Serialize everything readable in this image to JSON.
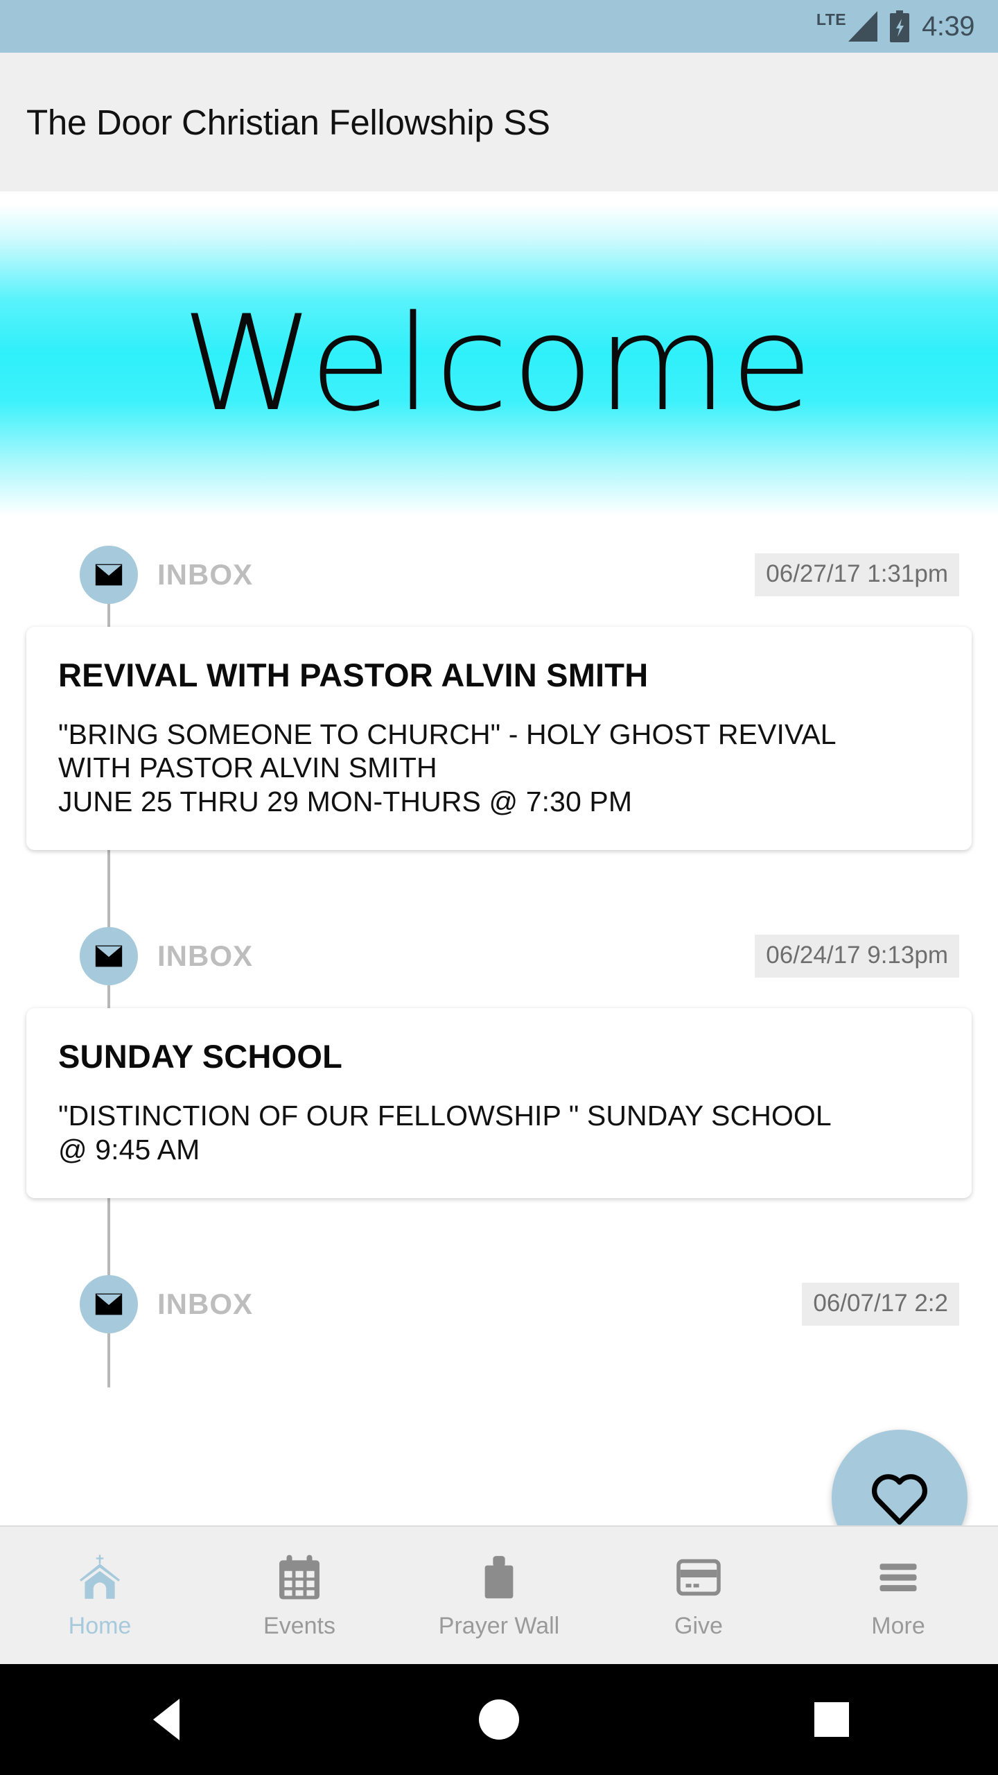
{
  "status_bar": {
    "network_label": "LTE",
    "time": "4:39",
    "battery_state": "charging"
  },
  "app_bar": {
    "title": "The Door Christian Fellowship SS"
  },
  "banner": {
    "text": "Welcome",
    "gradient_color": "#2FF0FA"
  },
  "colors": {
    "accent": "#A6CADC",
    "status_bar": "#9FC5D8",
    "app_bar": "#EFEFEF",
    "timestamp_badge": "#ECECEC",
    "inactive_nav": "#9A9A9A"
  },
  "feed": {
    "items": [
      {
        "source": "INBOX",
        "timestamp": "06/27/17 1:31pm",
        "title": "REVIVAL WITH PASTOR ALVIN SMITH",
        "body": "\"BRING SOMEONE TO CHURCH\" - HOLY GHOST REVIVAL\nWITH PASTOR ALVIN SMITH\nJUNE 25 THRU 29  MON-THURS @ 7:30 PM"
      },
      {
        "source": "INBOX",
        "timestamp": "06/24/17 9:13pm",
        "title": "SUNDAY SCHOOL",
        "body": "\"DISTINCTION OF OUR FELLOWSHIP \"  SUNDAY SCHOOL\n@ 9:45 AM"
      },
      {
        "source": "INBOX",
        "timestamp": "06/07/17 2:2",
        "title": "",
        "body": ""
      }
    ]
  },
  "fab": {
    "icon": "heart-icon"
  },
  "bottom_nav": {
    "items": [
      {
        "label": "Home",
        "icon": "church-icon",
        "active": true
      },
      {
        "label": "Events",
        "icon": "calendar-icon",
        "active": false
      },
      {
        "label": "Prayer Wall",
        "icon": "prayer-wall-icon",
        "active": false
      },
      {
        "label": "Give",
        "icon": "credit-card-icon",
        "active": false
      },
      {
        "label": "More",
        "icon": "hamburger-icon",
        "active": false
      }
    ]
  },
  "android_nav": {
    "back": "back-triangle",
    "home": "home-circle",
    "recents": "recents-square"
  }
}
